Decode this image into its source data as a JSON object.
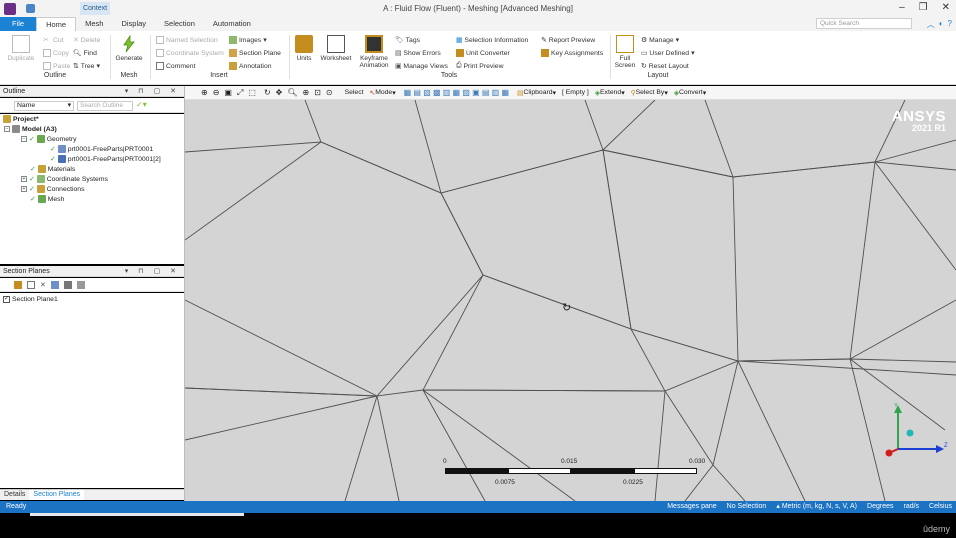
{
  "window": {
    "title": "A : Fluid Flow (Fluent) - Meshing [Advanced Meshing]",
    "context_tab": "Context"
  },
  "tabs": [
    "File",
    "Home",
    "Mesh",
    "Display",
    "Selection",
    "Automation"
  ],
  "active_tab": "Home",
  "quick_search_placeholder": "Quick Search",
  "ribbon": {
    "outline": {
      "label": "Outline",
      "duplicate": "Duplicate",
      "cut": "Cut",
      "copy": "Copy",
      "paste": "Paste",
      "delete": "Delete",
      "find": "Find",
      "tree": "Tree"
    },
    "mesh": {
      "label": "Mesh",
      "generate": "Generate"
    },
    "insert": {
      "label": "Insert",
      "named_selection": "Named Selection",
      "coordinate_system": "Coordinate System",
      "comment": "Comment",
      "images": "Images",
      "section_plane": "Section Plane",
      "annotation": "Annotation"
    },
    "tools": {
      "label": "Tools",
      "units": "Units",
      "worksheet": "Worksheet",
      "keyframe": "Keyframe",
      "animation": "Animation",
      "tags": "Tags",
      "show_errors": "Show Errors",
      "manage_views": "Manage Views",
      "selection_information": "Selection Information",
      "unit_converter": "Unit Converter",
      "print_preview": "Print Preview",
      "report_preview": "Report Preview",
      "key_assignments": "Key Assignments"
    },
    "layout": {
      "label": "Layout",
      "full": "Full",
      "screen": "Screen",
      "manage": "Manage",
      "user_defined": "User Defined",
      "reset_layout": "Reset Layout"
    }
  },
  "outline": {
    "title": "Outline",
    "name_label": "Name",
    "search_placeholder": "Search Outline",
    "tree": [
      "Project*",
      "Model (A3)",
      "Geometry",
      "prt0001-FreeParts|PRT0001",
      "prt0001-FreeParts|PRT0001[2]",
      "Materials",
      "Coordinate Systems",
      "Connections",
      "Mesh"
    ]
  },
  "section_planes": {
    "title": "Section Planes",
    "items": [
      "Section Plane1"
    ]
  },
  "bottom_tabs": [
    "Details",
    "Section Planes"
  ],
  "viewport_toolbar": {
    "select": "Select",
    "mode": "Mode",
    "clipboard": "Clipboard",
    "empty": "[ Empty ]",
    "extend": "Extend",
    "select_by": "Select By",
    "convert": "Convert"
  },
  "logo": {
    "brand": "ANSYS",
    "version": "2021 R1"
  },
  "scale_bar": {
    "top": [
      "0",
      "0.015",
      "0.030"
    ],
    "bottom": [
      "0.0075",
      "0.0225"
    ]
  },
  "triad": {
    "y": "Y",
    "z": "Z"
  },
  "status": {
    "left": "Ready",
    "messages": "Messages pane",
    "selection": "No Selection",
    "units": "Metric (m, kg, N, s, V, A)",
    "angle": "Degrees",
    "angular_velocity": "rad/s",
    "temperature": "Celsius"
  },
  "watermark": "ûdemy",
  "colors": {
    "accent": "#1c82d4",
    "statusbar": "#1c73c4",
    "viewport": "#d4d4d4"
  }
}
